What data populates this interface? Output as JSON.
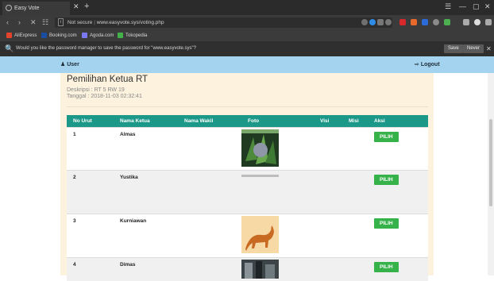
{
  "browser": {
    "tab_title": "Easy Vote",
    "url_security": "Not secure",
    "url": "www.easyvote.sys/voting.php",
    "bookmarks": [
      "AliExpress",
      "Booking.com",
      "Agoda.com",
      "Tokopedia"
    ],
    "password_prompt": "Would you like the password manager to save the password for \"www.easyvote.sys\"?",
    "save_label": "Save",
    "never_label": "Never"
  },
  "header": {
    "user_label": "User",
    "logout_label": "Logout"
  },
  "main": {
    "title": "Pemilihan Ketua RT",
    "description": "Deskripsi : RT 5 RW 19",
    "date": "Tanggal : 2018-11-03 02:32:41"
  },
  "table": {
    "headers": [
      "No Urut",
      "Nama Ketua",
      "Nama Wakil",
      "Foto",
      "Visi",
      "Misi",
      "Aksi"
    ],
    "rows": [
      {
        "no": "1",
        "ketua": "Almas",
        "wakil": "",
        "photo": "plants-photo",
        "action": "PILIH"
      },
      {
        "no": "2",
        "ketua": "Yustika",
        "wakil": "",
        "photo": "broken-image",
        "action": "PILIH"
      },
      {
        "no": "3",
        "ketua": "Kurniawan",
        "wakil": "",
        "photo": "cat-photo",
        "action": "PILIH"
      },
      {
        "no": "4",
        "ketua": "Dimas",
        "wakil": "",
        "photo": "street-photo",
        "action": "PILIH"
      }
    ]
  },
  "colors": {
    "header_bar": "#a3d3ef",
    "table_header": "#1b9888",
    "button": "#36b24a",
    "panel": "#fcf2de"
  }
}
